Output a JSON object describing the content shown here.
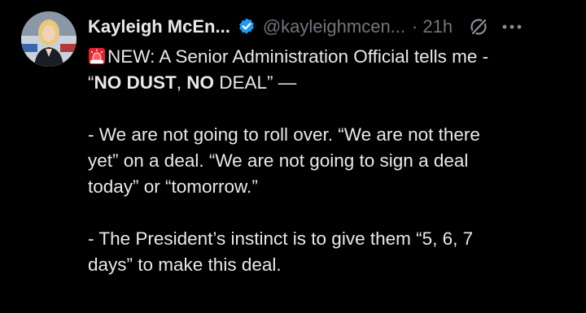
{
  "author": {
    "name": "Kayleigh McEn...",
    "handle": "@kayleighmcen...",
    "separator": "·",
    "time": "21h"
  },
  "icons": {
    "verified": "verified-badge-icon",
    "grok": "grok-icon",
    "more": "more-horizontal-icon",
    "siren": "police-light-emoji"
  },
  "colors": {
    "background": "#000000",
    "text": "#e7e9ea",
    "muted": "#71767b",
    "verified": "#1d9bf0"
  },
  "tweet": {
    "line1": "NEW: A Senior Administration Official tells me -",
    "line2_open": "“",
    "line2_bold1": "NO DUST",
    "line2_comma": ", ",
    "line2_bold2": "NO",
    "line2_rest": " DEAL” —",
    "para2_line1": "- We are not going to roll over. “We are not there",
    "para2_line2": "yet” on a deal. “We are not going to sign a deal",
    "para2_line3": "today” or “tomorrow.”",
    "para3_line1": "- The President’s instinct is to give them “5, 6, 7",
    "para3_line2": "days” to make this deal."
  }
}
